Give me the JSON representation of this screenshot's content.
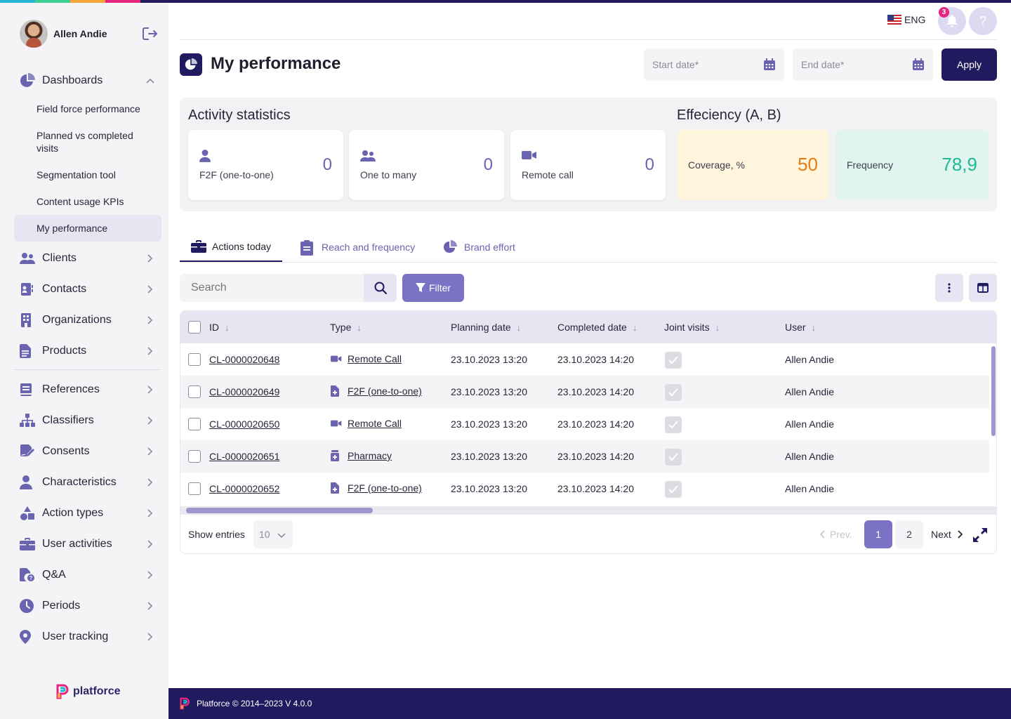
{
  "user": {
    "name": "Allen Andie"
  },
  "sidebar": {
    "dashboards": {
      "label": "Dashboards",
      "icon": "pie-chart-icon"
    },
    "sub_items": [
      {
        "label": "Field force performance"
      },
      {
        "label": "Planned vs completed visits"
      },
      {
        "label": "Segmentation tool"
      },
      {
        "label": "Content usage KPIs"
      },
      {
        "label": "My performance",
        "active": true
      }
    ],
    "items": [
      {
        "label": "Clients",
        "icon": "users-icon"
      },
      {
        "label": "Contacts",
        "icon": "contact-card-icon"
      },
      {
        "label": "Organizations",
        "icon": "building-icon"
      },
      {
        "label": "Products",
        "icon": "document-icon"
      },
      {
        "label": "References",
        "icon": "book-icon"
      },
      {
        "label": "Classifiers",
        "icon": "hierarchy-icon"
      },
      {
        "label": "Consents",
        "icon": "signature-icon"
      },
      {
        "label": "Characteristics",
        "icon": "person-icon"
      },
      {
        "label": "Action types",
        "icon": "shapes-icon"
      },
      {
        "label": "User activities",
        "icon": "briefcase-icon"
      },
      {
        "label": "Q&A",
        "icon": "file-question-icon"
      },
      {
        "label": "Periods",
        "icon": "clock-icon"
      },
      {
        "label": "User tracking",
        "icon": "location-pin-icon"
      }
    ],
    "logo_text": "platforce"
  },
  "header": {
    "lang": "ENG",
    "notification_count": "3",
    "help": "?"
  },
  "page": {
    "title": "My performance",
    "start_date_placeholder": "Start date*",
    "end_date_placeholder": "End date*",
    "apply_label": "Apply"
  },
  "activity": {
    "title": "Activity statistics",
    "cards": [
      {
        "label": "F2F (one-to-one)",
        "value": "0"
      },
      {
        "label": "One to many",
        "value": "0"
      },
      {
        "label": "Remote call",
        "value": "0"
      }
    ]
  },
  "efficiency": {
    "title": "Effeciency (A, B)",
    "coverage": {
      "label": "Coverage, %",
      "value": "50"
    },
    "frequency": {
      "label": "Frequency",
      "value": "78,9"
    }
  },
  "tabs": [
    {
      "label": "Actions today",
      "active": true
    },
    {
      "label": "Reach and frequency",
      "active": false
    },
    {
      "label": "Brand effort",
      "active": false
    }
  ],
  "toolbar": {
    "search_placeholder": "Search",
    "filter_label": "Filter"
  },
  "table": {
    "columns": [
      "ID",
      "Type",
      "Planning date",
      "Completed date",
      "Joint visits",
      "User"
    ],
    "rows": [
      {
        "id": "CL-0000020648",
        "type": "Remote Call",
        "type_icon": "video-icon",
        "planning": "23.10.2023 13:20",
        "completed": "23.10.2023 14:20",
        "joint": true,
        "user": "Allen Andie"
      },
      {
        "id": "CL-0000020649",
        "type": "F2F (one-to-one)",
        "type_icon": "medical-file-icon",
        "planning": "23.10.2023 13:20",
        "completed": "23.10.2023 14:20",
        "joint": true,
        "user": "Allen Andie"
      },
      {
        "id": "CL-0000020650",
        "type": "Remote Call",
        "type_icon": "video-icon",
        "planning": "23.10.2023 13:20",
        "completed": "23.10.2023 14:20",
        "joint": true,
        "user": "Allen Andie"
      },
      {
        "id": "CL-0000020651",
        "type": "Pharmacy",
        "type_icon": "pharmacy-icon",
        "planning": "23.10.2023 13:20",
        "completed": "23.10.2023 14:20",
        "joint": true,
        "user": "Allen Andie"
      },
      {
        "id": "CL-0000020652",
        "type": "F2F (one-to-one)",
        "type_icon": "medical-file-icon",
        "planning": "23.10.2023 13:20",
        "completed": "23.10.2023 14:20",
        "joint": true,
        "user": "Allen Andie"
      }
    ]
  },
  "pagination": {
    "show_entries_label": "Show entries",
    "entries_value": "10",
    "prev_label": "Prev.",
    "pages": [
      "1",
      "2"
    ],
    "current": "1",
    "next_label": "Next"
  },
  "footer": {
    "text": "Platforce © 2014–2023 V 4.0.0"
  },
  "colors": {
    "accent": "#221a5e",
    "primary": "#6a63b0",
    "coverage_bg": "#fff4dc",
    "coverage_fg": "#e87a12",
    "frequency_bg": "#dff5ee",
    "frequency_fg": "#1fb894"
  }
}
